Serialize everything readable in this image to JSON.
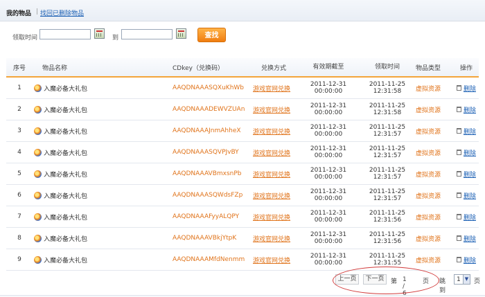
{
  "topbar": {
    "title": "我的物品",
    "separator": "|",
    "recover_link": "找回已删除物品"
  },
  "filters": {
    "from_label": "领取时间",
    "to_label": "到",
    "from_value": "",
    "to_value": "",
    "search_label": "查找"
  },
  "columns": [
    "序号",
    "物品名称",
    "CDkey（兑换码）",
    "兑换方式",
    "有效期截至",
    "领取时间",
    "物品类型",
    "操作"
  ],
  "rows": [
    {
      "idx": "1",
      "name": "入魔必备大礼包",
      "key": "AAQDNAAASQXuKhWb",
      "exchange": "游戏官网兑换",
      "exp_date": "2011-12-31",
      "exp_time": "00:00:00",
      "rec_date": "2011-11-25",
      "rec_time": "12:31:58",
      "type": "虚拟资源",
      "action": "删除"
    },
    {
      "idx": "2",
      "name": "入魔必备大礼包",
      "key": "AAQDNAAADEWVZUAn",
      "exchange": "游戏官网兑换",
      "exp_date": "2011-12-31",
      "exp_time": "00:00:00",
      "rec_date": "2011-11-25",
      "rec_time": "12:31:58",
      "type": "虚拟资源",
      "action": "删除"
    },
    {
      "idx": "3",
      "name": "入魔必备大礼包",
      "key": "AAQDNAAAJnmAhheX",
      "exchange": "游戏官网兑换",
      "exp_date": "2011-12-31",
      "exp_time": "00:00:00",
      "rec_date": "2011-11-25",
      "rec_time": "12:31:57",
      "type": "虚拟资源",
      "action": "删除"
    },
    {
      "idx": "4",
      "name": "入魔必备大礼包",
      "key": "AAQDNAAASQVPJvBY",
      "exchange": "游戏官网兑换",
      "exp_date": "2011-12-31",
      "exp_time": "00:00:00",
      "rec_date": "2011-11-25",
      "rec_time": "12:31:57",
      "type": "虚拟资源",
      "action": "删除"
    },
    {
      "idx": "5",
      "name": "入魔必备大礼包",
      "key": "AAQDNAAAVBmxsnPb",
      "exchange": "游戏官网兑换",
      "exp_date": "2011-12-31",
      "exp_time": "00:00:00",
      "rec_date": "2011-11-25",
      "rec_time": "12:31:57",
      "type": "虚拟资源",
      "action": "删除"
    },
    {
      "idx": "6",
      "name": "入魔必备大礼包",
      "key": "AAQDNAAASQWdsFZp",
      "exchange": "游戏官网兑换",
      "exp_date": "2011-12-31",
      "exp_time": "00:00:00",
      "rec_date": "2011-11-25",
      "rec_time": "12:31:57",
      "type": "虚拟资源",
      "action": "删除"
    },
    {
      "idx": "7",
      "name": "入魔必备大礼包",
      "key": "AAQDNAAAFyyALQPY",
      "exchange": "游戏官网兑换",
      "exp_date": "2011-12-31",
      "exp_time": "00:00:00",
      "rec_date": "2011-11-25",
      "rec_time": "12:31:56",
      "type": "虚拟资源",
      "action": "删除"
    },
    {
      "idx": "8",
      "name": "入魔必备大礼包",
      "key": "AAQDNAAAVBkjYtpK",
      "exchange": "游戏官网兑换",
      "exp_date": "2011-12-31",
      "exp_time": "00:00:00",
      "rec_date": "2011-11-25",
      "rec_time": "12:31:56",
      "type": "虚拟资源",
      "action": "删除"
    },
    {
      "idx": "9",
      "name": "入魔必备大礼包",
      "key": "AAQDNAAAMfdNenmm",
      "exchange": "游戏官网兑换",
      "exp_date": "2011-12-31",
      "exp_time": "00:00:00",
      "rec_date": "2011-11-25",
      "rec_time": "12:31:55",
      "type": "虚拟资源",
      "action": "删除"
    }
  ],
  "pager": {
    "prev_label": "上一页",
    "next_label": "下一页",
    "page_prefix": "第",
    "page_info": "1 / 6",
    "page_suffix": "页",
    "jump_label": "跳到",
    "jump_value": "1",
    "jump_suffix": "页"
  },
  "colors": {
    "accent": "#f07d10",
    "link": "#1a5fb4",
    "highlight_ring": "#d23b3b"
  },
  "icons": {
    "item": "gift-orb-icon",
    "calendar": "calendar-icon",
    "delete": "trash-icon"
  }
}
